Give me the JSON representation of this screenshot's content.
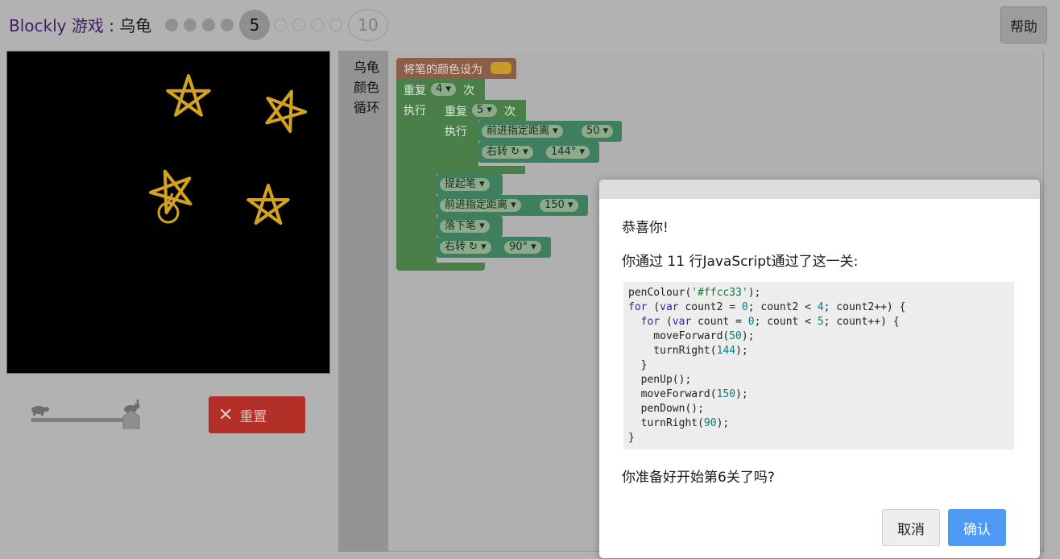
{
  "header": {
    "brand": "Blockly 游戏",
    "separator": " : ",
    "game": "乌龟",
    "current_level": "5",
    "last_level": "10",
    "help_label": "帮助"
  },
  "controls": {
    "reset_label": "重置"
  },
  "toolbox": {
    "categories": [
      "乌龟",
      "颜色",
      "循环"
    ]
  },
  "blocks": {
    "set_colour": "将笔的颜色设为",
    "colour_value": "#ffcc33",
    "repeat": "重复",
    "times": "次",
    "do": "执行",
    "outer_count": "4",
    "inner_count": "5",
    "move_forward": "前进指定距离",
    "move_50": "50",
    "turn_right": "右转 ↻",
    "turn_144": "144°",
    "pen_up": "提起笔",
    "move_150": "150",
    "pen_down": "落下笔",
    "turn_90": "90°"
  },
  "dialog": {
    "congrats": "恭喜你!",
    "summary": "你通过 11 行JavaScript通过了这一关:",
    "code_lines": [
      "penColour('#ffcc33');",
      "for (var count2 = 0; count2 < 4; count2++) {",
      "  for (var count = 0; count < 5; count++) {",
      "    moveForward(50);",
      "    turnRight(144);",
      "  }",
      "  penUp();",
      "  moveForward(150);",
      "  penDown();",
      "  turnRight(90);",
      "}"
    ],
    "question": "你准备好开始第6关了吗?",
    "cancel_label": "取消",
    "ok_label": "确认"
  },
  "colors": {
    "star": "#d4a21e",
    "reset": "#b23028",
    "ok": "#4e9af5"
  }
}
